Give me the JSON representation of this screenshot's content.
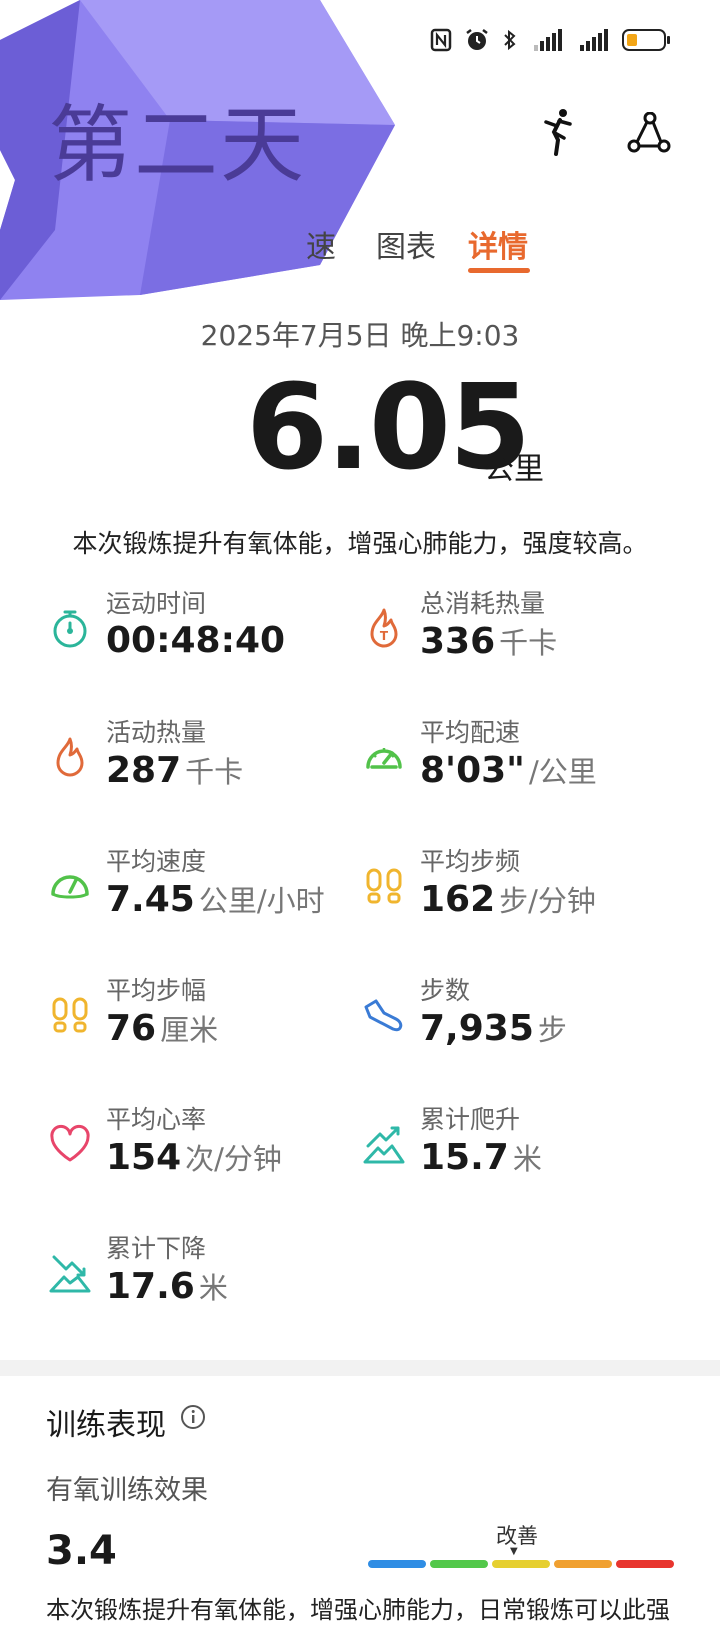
{
  "sticker": {
    "text": "第二天"
  },
  "tabs": [
    {
      "label": "速"
    },
    {
      "label": "图表"
    },
    {
      "label": "详情"
    }
  ],
  "workout": {
    "datetime": "2025年7月5日 晚上9:03",
    "distance": "6.05",
    "distance_unit": "公里",
    "summary": "本次锻炼提升有氧体能，增强心肺能力，强度较高。"
  },
  "metrics": [
    {
      "label": "运动时间",
      "value": "00:48:40",
      "unit": "",
      "icon": "stopwatch-icon"
    },
    {
      "label": "总消耗热量",
      "value": "336",
      "unit": "千卡",
      "icon": "calorie-flame-icon"
    },
    {
      "label": "活动热量",
      "value": "287",
      "unit": "千卡",
      "icon": "flame-icon"
    },
    {
      "label": "平均配速",
      "value": "8'03\"",
      "unit": "/公里",
      "icon": "speedometer-icon"
    },
    {
      "label": "平均速度",
      "value": "7.45",
      "unit": "公里/小时",
      "icon": "gauge-icon"
    },
    {
      "label": "平均步频",
      "value": "162",
      "unit": "步/分钟",
      "icon": "footprints-icon"
    },
    {
      "label": "平均步幅",
      "value": "76",
      "unit": "厘米",
      "icon": "stride-icon"
    },
    {
      "label": "步数",
      "value": "7,935",
      "unit": "步",
      "icon": "shoe-icon"
    },
    {
      "label": "平均心率",
      "value": "154",
      "unit": "次/分钟",
      "icon": "heart-icon"
    },
    {
      "label": "累计爬升",
      "value": "15.7",
      "unit": "米",
      "icon": "ascent-icon"
    },
    {
      "label": "累计下降",
      "value": "17.6",
      "unit": "米",
      "icon": "descent-icon"
    }
  ],
  "training": {
    "section_title": "训练表现",
    "aerobic_title": "有氧训练效果",
    "aerobic_score": "3.4",
    "level_label": "改善",
    "scale_colors": [
      "#2f8de4",
      "#52c84a",
      "#e6cf2f",
      "#f0a030",
      "#e8352e"
    ],
    "description": "本次锻炼提升有氧体能，增强心肺能力，日常锻炼可以此强"
  },
  "colors": {
    "accent": "#e8692e",
    "sticker": "#8f82f0"
  }
}
